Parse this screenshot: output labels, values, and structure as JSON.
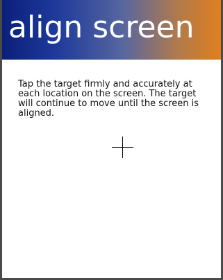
{
  "title": "align screen",
  "instructions": "Tap the target firmly and accurately at each location on the screen. The target will continue to move until the screen is aligned.",
  "colors": {
    "title_gradient_start": "#0a1f7a",
    "title_gradient_end": "#e07f1e",
    "title_text": "#ffffff",
    "body_text": "#111111",
    "background": "#ffffff"
  },
  "icons": {
    "target": "crosshair-icon"
  }
}
